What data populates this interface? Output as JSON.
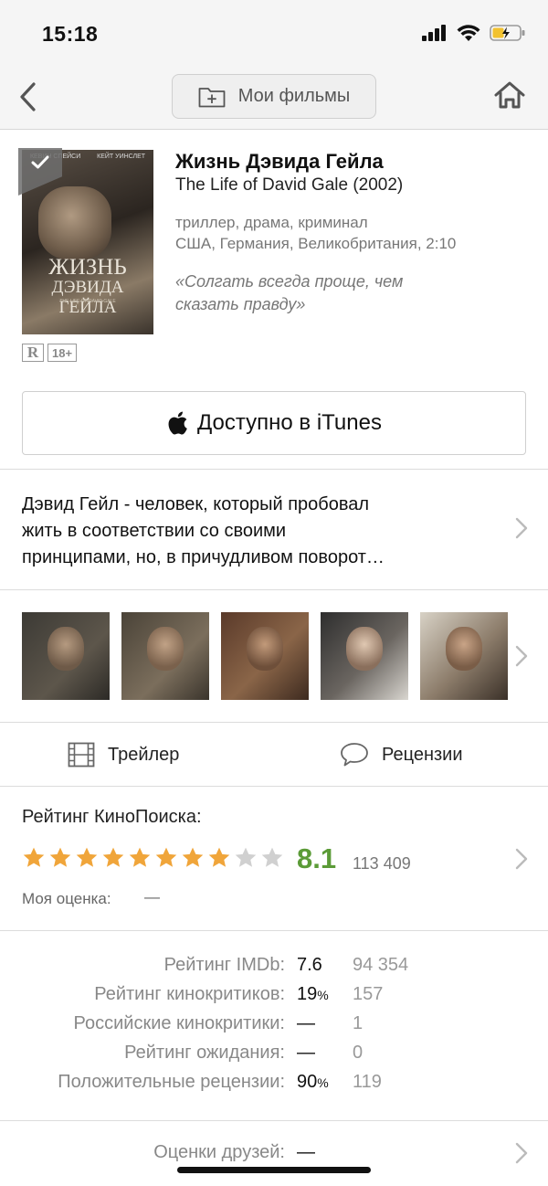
{
  "status_bar": {
    "time": "15:18"
  },
  "nav": {
    "my_films_label": "Мои фильмы"
  },
  "movie": {
    "title_ru": "Жизнь Дэвида Гейла",
    "title_en": "The Life of David Gale (2002)",
    "genres": "триллер, драма, криминал",
    "countries_duration": "США, Германия, Великобритания, 2:10",
    "tagline_line1": "«Солгать всегда проще, чем",
    "tagline_line2": "сказать правду»",
    "poster": {
      "title_line1": "ЖИЗНЬ",
      "title_line2": "ДЭВИДА ГЕЙЛА",
      "subtitle": "THE LIFE OF DAVID GALE",
      "actor1": "КЕВИН СПЕЙСИ",
      "actor2": "КЕЙТ УИНСЛЕТ"
    },
    "mpaa": "R",
    "age": "18+"
  },
  "itunes": {
    "label": "Доступно в iTunes"
  },
  "synopsis": {
    "line1": "Дэвид Гейл - человек, который пробовал",
    "line2": "жить в соответствии со своими",
    "line3": "принципами, но, в причудливом поворот…"
  },
  "tabs": {
    "trailer": "Трейлер",
    "reviews": "Рецензии"
  },
  "kinopoisk": {
    "label": "Рейтинг КиноПоиска:",
    "value": "8.1",
    "votes": "113 409",
    "stars_filled": 8,
    "stars_total": 10,
    "my_rating_label": "Моя оценка:",
    "my_rating_value": "—"
  },
  "ratings": [
    {
      "label": "Рейтинг IMDb:",
      "value": "7.6",
      "suffix": "",
      "count": "94 354"
    },
    {
      "label": "Рейтинг кинокритиков:",
      "value": "19",
      "suffix": "%",
      "count": "157"
    },
    {
      "label": "Российские кинокритики:",
      "value": "—",
      "suffix": "",
      "count": "1"
    },
    {
      "label": "Рейтинг ожидания:",
      "value": "—",
      "suffix": "",
      "count": "0"
    },
    {
      "label": "Положительные рецензии:",
      "value": "90",
      "suffix": "%",
      "count": "119"
    }
  ],
  "friends": {
    "label": "Оценки друзей:",
    "value": "—"
  },
  "colors": {
    "rating_green": "#5b9b37",
    "star_gold": "#f0a53a",
    "star_gray": "#d0d0d0"
  }
}
